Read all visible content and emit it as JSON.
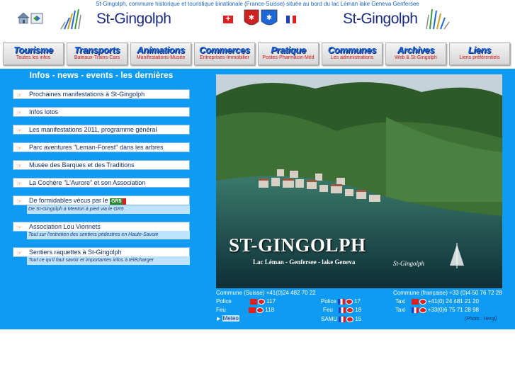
{
  "header": {
    "tagline": "St-Gingolph, commune  historique et touristique binationale (France-Suisse) située au bord du lac Léman lake Geneva Genfersee",
    "logo_left": "St-Gingolph",
    "logo_right": "St-Gingolph"
  },
  "nav": [
    {
      "title": "Tourisme",
      "sub": "Toutes les infos"
    },
    {
      "title": "Transports",
      "sub": "Bateaux-Trains-Cars"
    },
    {
      "title": "Animations",
      "sub": "Manifestations-Musée"
    },
    {
      "title": "Commerces",
      "sub": "Entreprises-Immobilier"
    },
    {
      "title": "Pratique",
      "sub": "Postes-Pharmacie-Méd"
    },
    {
      "title": "Communes",
      "sub": "Les administrations"
    },
    {
      "title": "Archives",
      "sub": "Web & St-Gingolph"
    },
    {
      "title": "Liens",
      "sub": "Liens préférentiels"
    }
  ],
  "news": {
    "title": "Infos - news - events - les dernières",
    "items": [
      {
        "label": "Prochaines manifestations à St-Gingolph"
      },
      {
        "label": "Infos lotos"
      },
      {
        "label": "Les manifestations 2011, programme général"
      },
      {
        "label": "Parc aventures \"Leman-Forest\" dans les arbres"
      },
      {
        "label": "Musée des Barques et des Traditions"
      },
      {
        "label": "La Cochère \"L'Aurore\" et son Association"
      },
      {
        "label": "De formidables vécus par le",
        "badge": "GR5",
        "sub": "De St-Gingolph à Menton à pied via le GR5"
      },
      {
        "label": "Association Lou Vionnets",
        "sub": "Tout sur l'entretien des sentiers pédestres en Haute-Savoie"
      },
      {
        "label": "Sentiers raquettes à St-Gingolph",
        "sub": "Tout ce qu'il faut savoir et importantes infos à télécharger"
      }
    ]
  },
  "photo": {
    "title": "ST-GINGOLPH",
    "subtitle": "Lac Léman - Genfersee - lake Geneva",
    "signature": "St-Gingolph"
  },
  "contacts": {
    "commune_ch": "Commune (Suisse) +41(0)24 482 70 22",
    "commune_fr": "Commune (française) +33 (0)4 50 76 72 28",
    "police_ch_label": "Police",
    "police_ch_num": "117",
    "feu_ch_label": "Feu",
    "feu_ch_num": "118",
    "police_fr_label": "Police",
    "police_fr_num": "17",
    "feu_fr_label": "Feu",
    "feu_fr_num": "18",
    "samu_label": "SAMU",
    "samu_num": "15",
    "taxi1_label": "Taxi",
    "taxi1_num": "+41(0) 24 481 21 20",
    "taxi2_label": "Taxi",
    "taxi2_num": "+33(0)6 75 71 28 98",
    "meteo": "Meteo",
    "credit": "(Photo : Hergi)"
  },
  "colors": {
    "main_bg": "#0f9bf2",
    "nav_title": "#1f66d8",
    "nav_sub": "#d01010",
    "swiss_red": "#e02020",
    "fr_blue": "#1f3fc0"
  }
}
